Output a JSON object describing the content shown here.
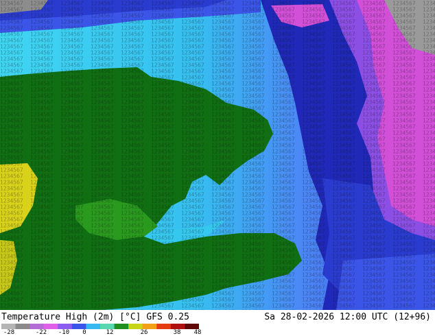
{
  "map": {
    "title": "Temperature High (2m) [°C] GFS 0.25",
    "datetime": "Sa 28-02-2026 12:00 UTC (12+96)",
    "colors": {
      "land_green": "#0f6f12",
      "land_green_light": "#2a9a1e",
      "arid_yellow": "#d8d21a",
      "sea_cyan": "#35c8ee",
      "sea_light_blue": "#5aa0ff",
      "sea_blue": "#3b55e8",
      "deep_blue": "#1417a0",
      "violet": "#8c4fe6",
      "magenta": "#d24fd8",
      "grey": "#8d8d8d",
      "digit_dark": "#1a1a1a"
    }
  },
  "colorbar": {
    "ticks": [
      "-28",
      "-22",
      "-10",
      "0",
      "12",
      "26",
      "38",
      "48"
    ],
    "stops": [
      "#b4b4b4",
      "#8a8a8a",
      "#b36bd6",
      "#e05fe8",
      "#8a5cf0",
      "#3b55e8",
      "#38b8f0",
      "#58d8b0",
      "#1f8f1f",
      "#c8d418",
      "#f4a016",
      "#e43c10",
      "#b01010",
      "#600808"
    ]
  }
}
